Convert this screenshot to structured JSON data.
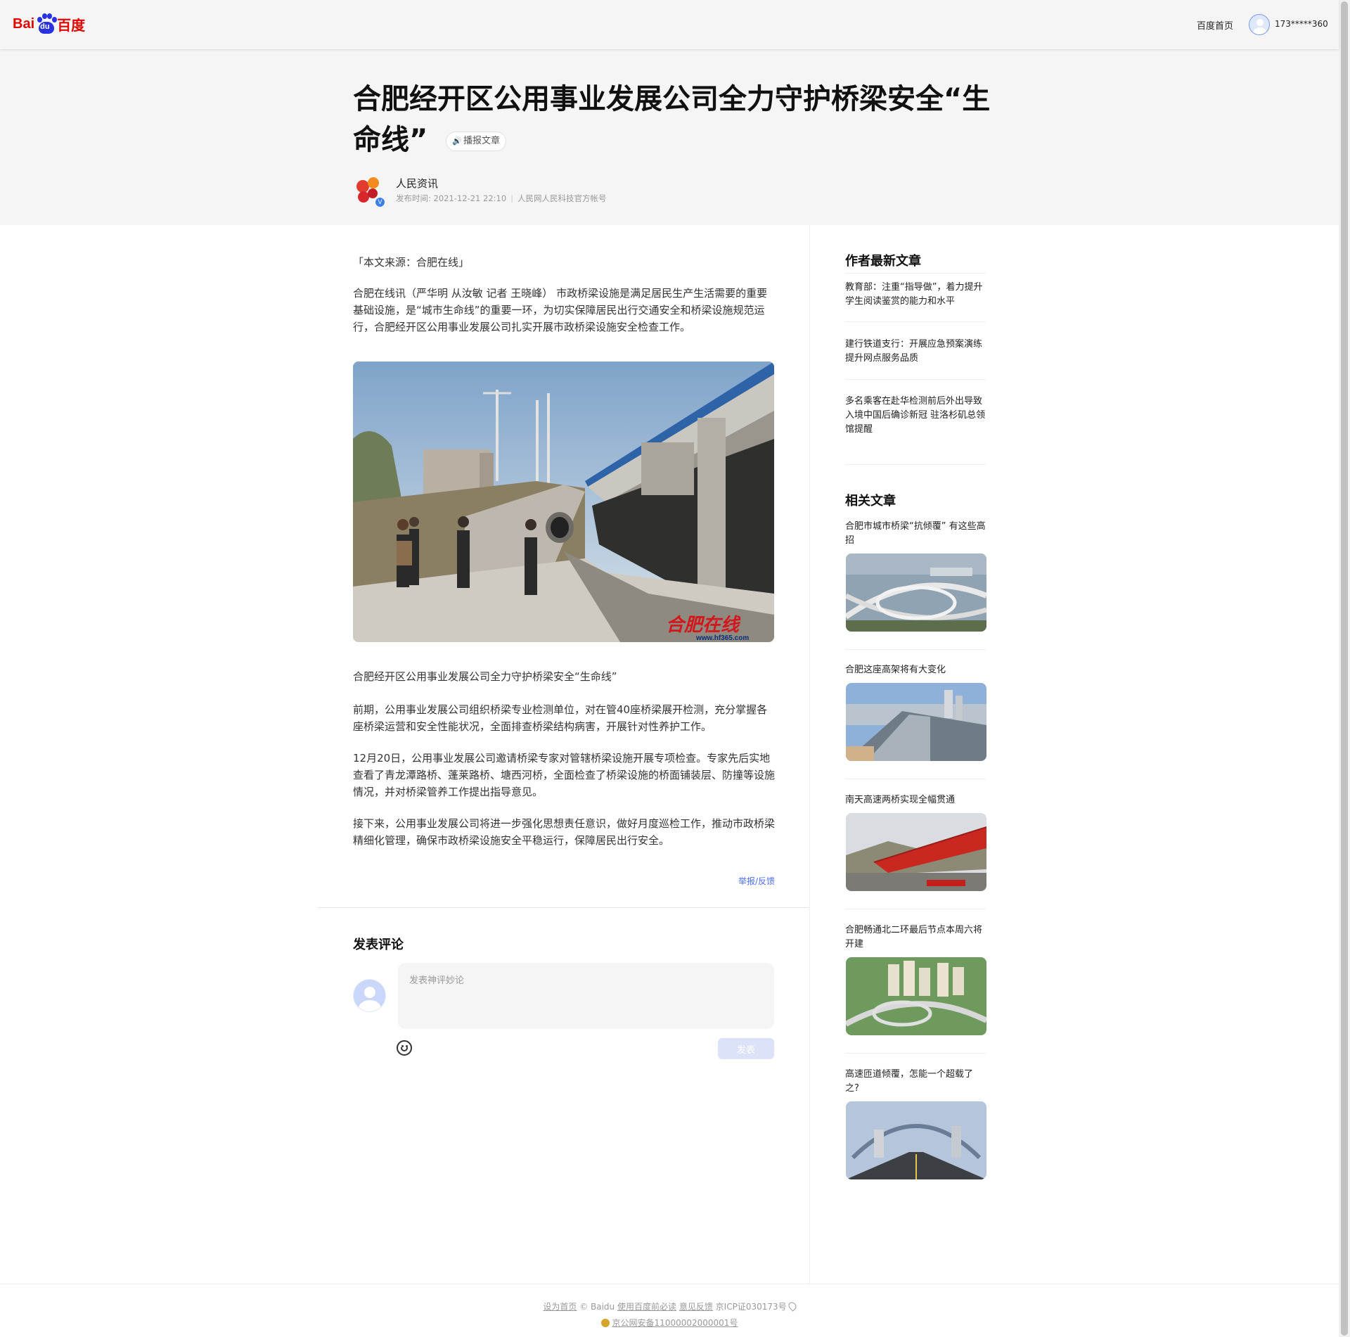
{
  "topbar": {
    "logo_bai": "Bai",
    "logo_du": "du",
    "logo_cn": "百度",
    "home_link": "百度首页",
    "user_name": "173*****360"
  },
  "article": {
    "title": "合肥经开区公用事业发展公司全力守护桥梁安全“生命线”",
    "listen_label": "播报文章",
    "author": "人民资讯",
    "publish_time": "发布时间: 2021-12-21 22:10",
    "account_desc": "人民网人民科技官方帐号",
    "source_line": "「本文来源：合肥在线」",
    "paragraphs": [
      "合肥在线讯（严华明 从汝敏 记者 王晓峰） 市政桥梁设施是满足居民生产生活需要的重要基础设施，是“城市生命线”的重要一环，为切实保障居民出行交通安全和桥梁设施规范运行，合肥经开区公用事业发展公司扎实开展市政桥梁设施安全检查工作。",
      "前期，公用事业发展公司组织桥梁专业检测单位，对在管40座桥梁展开检测，充分掌握各座桥梁运营和安全性能状况，全面排查桥梁结构病害，开展针对性养护工作。",
      "12月20日，公用事业发展公司邀请桥梁专家对管辖桥梁设施开展专项检查。专家先后实地查看了青龙潭路桥、蓬莱路桥、塘西河桥，全面检查了桥梁设施的桥面铺装层、防撞等设施情况，并对桥梁管养工作提出指导意见。",
      "接下来，公用事业发展公司将进一步强化思想责任意识，做好月度巡检工作，推动市政桥梁精细化管理，确保市政桥梁设施安全平稳运行，保障居民出行安全。"
    ],
    "image_caption": "合肥经开区公用事业发展公司全力守护桥梁安全“生命线”",
    "watermark": "合肥在线",
    "watermark_url": "www.hf365.com",
    "report_link": "举报/反馈"
  },
  "comments": {
    "title": "发表评论",
    "placeholder": "发表神评妙论",
    "send_label": "发表"
  },
  "sidebar": {
    "latest_heading": "作者最新文章",
    "latest": [
      "教育部：注重“指导做”，着力提升学生阅读鉴赏的能力和水平",
      "建行铁道支行：开展应急预案演练 提升网点服务品质",
      "多名乘客在赴华检测前后外出导致入境中国后确诊新冠 驻洛杉矶总领馆提醒"
    ],
    "related_heading": "相关文章",
    "related": [
      {
        "title": "合肥市城市桥梁“抗倾覆” 有这些高招"
      },
      {
        "title": "合肥这座高架将有大变化"
      },
      {
        "title": "南天高速两桥实现全幅贯通"
      },
      {
        "title": "合肥畅通北二环最后节点本周六将开建"
      },
      {
        "title": "高速匝道倾覆，怎能一个超载了之?"
      }
    ]
  },
  "footer": {
    "set_home": "设为首页",
    "copyright": "© Baidu",
    "must_read": "使用百度前必读",
    "feedback": "意见反馈",
    "icp": "京ICP证030173号",
    "police": "京公网安备11000002000001号"
  },
  "colors": {
    "baidu_red": "#e10601",
    "baidu_blue": "#2932e1",
    "link_blue": "#4e6ef2"
  }
}
